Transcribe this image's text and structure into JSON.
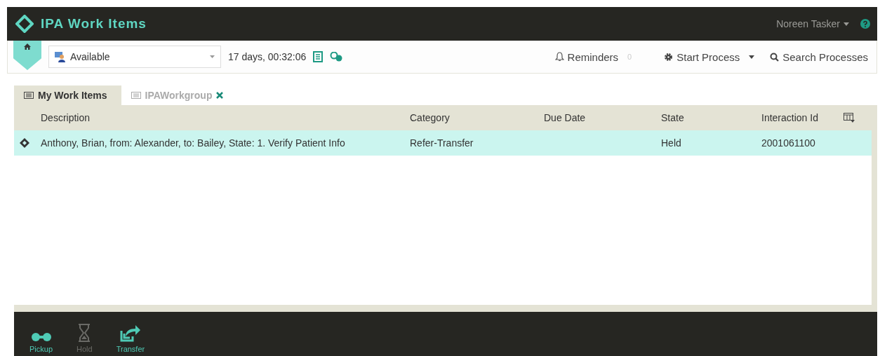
{
  "header": {
    "title": "IPA Work Items",
    "user": "Noreen Tasker"
  },
  "toolbar": {
    "status": "Available",
    "timer": "17 days, 00:32:06",
    "reminders": {
      "label": "Reminders",
      "count": "0"
    },
    "start_process": "Start Process",
    "search": "Search Processes"
  },
  "tabs": [
    {
      "label": "My Work Items",
      "selected": true,
      "closable": false
    },
    {
      "label": "IPAWorkgroup",
      "selected": false,
      "closable": true
    }
  ],
  "table": {
    "columns": [
      "Description",
      "Category",
      "Due Date",
      "State",
      "Interaction Id"
    ],
    "rows": [
      {
        "selected": true,
        "cells": [
          "Anthony, Brian, from: Alexander, to: Bailey, State: 1. Verify Patient Info",
          "Refer-Transfer",
          "",
          "Held",
          "2001061100"
        ]
      }
    ]
  },
  "actions": [
    {
      "kind": "pickup",
      "label": "Pickup",
      "disabled": false
    },
    {
      "kind": "hold",
      "label": "Hold",
      "disabled": true
    },
    {
      "kind": "transfer",
      "label": "Transfer",
      "disabled": false
    }
  ]
}
